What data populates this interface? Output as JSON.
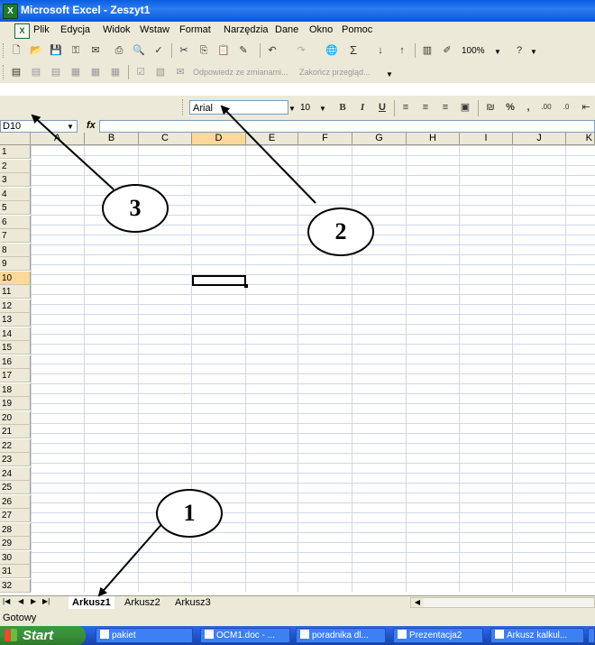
{
  "window": {
    "title": "Microsoft Excel - Zeszyt1"
  },
  "menu": [
    "Plik",
    "Edycja",
    "Widok",
    "Wstaw",
    "Format",
    "Narzędzia",
    "Dane",
    "Okno",
    "Pomoc"
  ],
  "toolbar": {
    "zoom": "100%",
    "review_reply": "Odpowiedz ze zmianami...",
    "review_end": "Zakończ przegląd..."
  },
  "formatting": {
    "font": "Arial",
    "size": "10"
  },
  "formula_bar": {
    "name_box": "D10",
    "fx": "fx"
  },
  "grid": {
    "columns": [
      "A",
      "B",
      "C",
      "D",
      "E",
      "F",
      "G",
      "H",
      "I",
      "J",
      "K"
    ],
    "rows": [
      "1",
      "2",
      "3",
      "4",
      "5",
      "6",
      "7",
      "8",
      "9",
      "10",
      "11",
      "12",
      "13",
      "14",
      "15",
      "16",
      "17",
      "18",
      "19",
      "20",
      "21",
      "22",
      "23",
      "24",
      "25",
      "26",
      "27",
      "28",
      "29",
      "30",
      "31",
      "32"
    ],
    "selected_column": "D",
    "selected_row": "10"
  },
  "sheets": {
    "tabs": [
      "Arkusz1",
      "Arkusz2",
      "Arkusz3"
    ],
    "active": "Arkusz1"
  },
  "status": "Gotowy",
  "taskbar": {
    "start": "Start",
    "tasks": [
      "pakiet",
      "OCM1.doc - ...",
      "poradnika dl...",
      "Prezentacja2",
      "Arkusz kalkul..."
    ]
  },
  "callouts": [
    "1",
    "2",
    "3"
  ]
}
